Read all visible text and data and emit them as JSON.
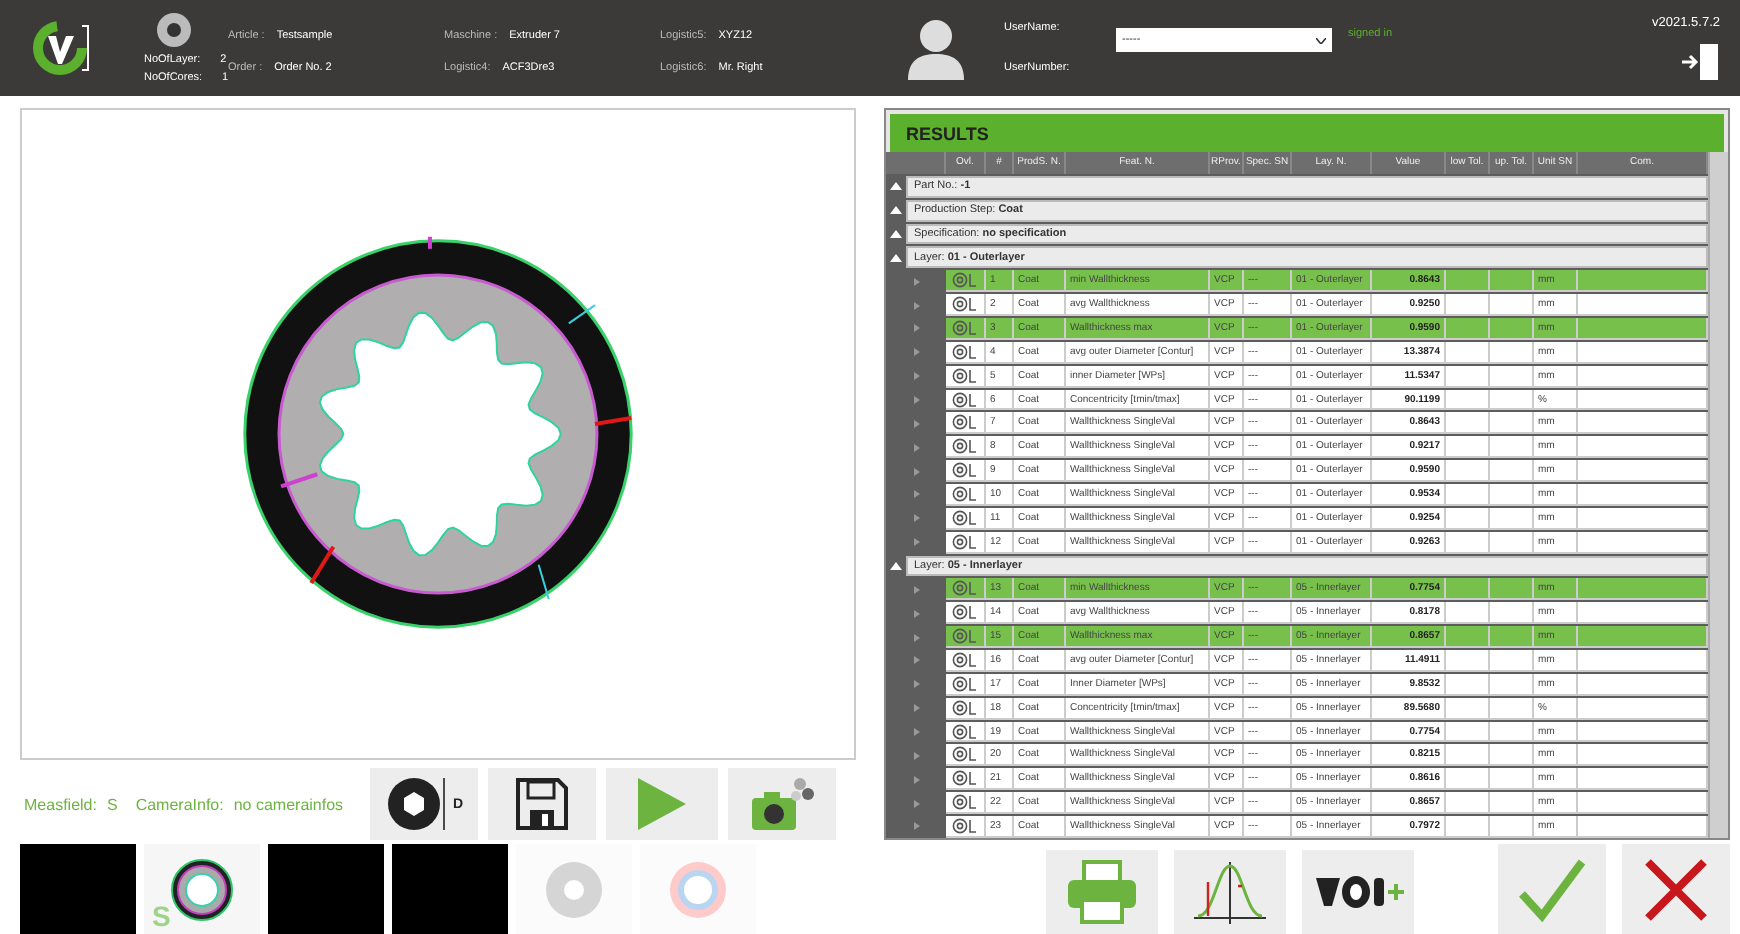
{
  "header": {
    "counts": [
      {
        "label": "NoOfLayer:",
        "value": "2"
      },
      {
        "label": "NoOfCores:",
        "value": "1"
      }
    ],
    "fields": [
      [
        {
          "label": "Article :",
          "value": "Testsample"
        },
        {
          "label": "Order :",
          "value": "Order No. 2"
        }
      ],
      [
        {
          "label": "Maschine :",
          "value": "Extruder 7"
        },
        {
          "label": "Logistic4:",
          "value": "ACF3Dre3"
        }
      ],
      [
        {
          "label": "Logistic5:",
          "value": "XYZ12"
        },
        {
          "label": "Logistic6:",
          "value": "Mr. Right"
        }
      ]
    ],
    "user": {
      "name_label": "UserName:",
      "name_value": "-----",
      "status": "signed in",
      "number_label": "UserNumber:"
    },
    "version": "v2021.5.7.2"
  },
  "diameter_label": "D",
  "status": [
    {
      "label": "Measfield:",
      "value": "S"
    },
    {
      "label": "CameraInfo:",
      "value": "no camerainfos"
    }
  ],
  "results": {
    "title": "RESULTS",
    "columns": [
      "Ovl.",
      "#",
      "ProdS. N.",
      "Feat. N.",
      "RProv.",
      "Spec. SN",
      "Lay. N.",
      "Value",
      "low Tol.",
      "up. Tol.",
      "Unit SN",
      "Com."
    ],
    "lines": [
      {
        "kind": "group",
        "label": "Part No.:",
        "value": "-1"
      },
      {
        "kind": "group",
        "label": "Production Step:",
        "value": "Coat"
      },
      {
        "kind": "group",
        "label": "Specification:",
        "value": "no specification"
      },
      {
        "kind": "group",
        "label": "Layer:",
        "value": "01 - Outerlayer"
      },
      {
        "kind": "row",
        "num": "1",
        "prod": "Coat",
        "feat": "min Wallthickness",
        "rprov": "VCP",
        "spec": "---",
        "layer": "01 - Outerlayer",
        "value": "0.8643",
        "unit": "mm",
        "highlighted": true
      },
      {
        "kind": "row",
        "num": "2",
        "prod": "Coat",
        "feat": "avg Wallthickness",
        "rprov": "VCP",
        "spec": "---",
        "layer": "01 - Outerlayer",
        "value": "0.9250",
        "unit": "mm",
        "highlighted": false
      },
      {
        "kind": "row",
        "num": "3",
        "prod": "Coat",
        "feat": "Wallthickness max",
        "rprov": "VCP",
        "spec": "---",
        "layer": "01 - Outerlayer",
        "value": "0.9590",
        "unit": "mm",
        "highlighted": true
      },
      {
        "kind": "row",
        "num": "4",
        "prod": "Coat",
        "feat": "avg outer Diameter [Contur]",
        "rprov": "VCP",
        "spec": "---",
        "layer": "01 - Outerlayer",
        "value": "13.3874",
        "unit": "mm",
        "highlighted": false
      },
      {
        "kind": "row",
        "num": "5",
        "prod": "Coat",
        "feat": "inner Diameter [WPs]",
        "rprov": "VCP",
        "spec": "---",
        "layer": "01 - Outerlayer",
        "value": "11.5347",
        "unit": "mm",
        "highlighted": false
      },
      {
        "kind": "row",
        "num": "6",
        "prod": "Coat",
        "feat": "Concentricity [tmin/tmax]",
        "rprov": "VCP",
        "spec": "---",
        "layer": "01 - Outerlayer",
        "value": "90.1199",
        "unit": "%",
        "highlighted": false
      },
      {
        "kind": "row",
        "num": "7",
        "prod": "Coat",
        "feat": "Wallthickness SingleVal",
        "rprov": "VCP",
        "spec": "---",
        "layer": "01 - Outerlayer",
        "value": "0.8643",
        "unit": "mm",
        "highlighted": false
      },
      {
        "kind": "row",
        "num": "8",
        "prod": "Coat",
        "feat": "Wallthickness SingleVal",
        "rprov": "VCP",
        "spec": "---",
        "layer": "01 - Outerlayer",
        "value": "0.9217",
        "unit": "mm",
        "highlighted": false
      },
      {
        "kind": "row",
        "num": "9",
        "prod": "Coat",
        "feat": "Wallthickness SingleVal",
        "rprov": "VCP",
        "spec": "---",
        "layer": "01 - Outerlayer",
        "value": "0.9590",
        "unit": "mm",
        "highlighted": false
      },
      {
        "kind": "row",
        "num": "10",
        "prod": "Coat",
        "feat": "Wallthickness SingleVal",
        "rprov": "VCP",
        "spec": "---",
        "layer": "01 - Outerlayer",
        "value": "0.9534",
        "unit": "mm",
        "highlighted": false
      },
      {
        "kind": "row",
        "num": "11",
        "prod": "Coat",
        "feat": "Wallthickness SingleVal",
        "rprov": "VCP",
        "spec": "---",
        "layer": "01 - Outerlayer",
        "value": "0.9254",
        "unit": "mm",
        "highlighted": false
      },
      {
        "kind": "row",
        "num": "12",
        "prod": "Coat",
        "feat": "Wallthickness SingleVal",
        "rprov": "VCP",
        "spec": "---",
        "layer": "01 - Outerlayer",
        "value": "0.9263",
        "unit": "mm",
        "highlighted": false
      },
      {
        "kind": "group",
        "label": "Layer:",
        "value": "05 - Innerlayer"
      },
      {
        "kind": "row",
        "num": "13",
        "prod": "Coat",
        "feat": "min Wallthickness",
        "rprov": "VCP",
        "spec": "---",
        "layer": "05 - Innerlayer",
        "value": "0.7754",
        "unit": "mm",
        "highlighted": true
      },
      {
        "kind": "row",
        "num": "14",
        "prod": "Coat",
        "feat": "avg Wallthickness",
        "rprov": "VCP",
        "spec": "---",
        "layer": "05 - Innerlayer",
        "value": "0.8178",
        "unit": "mm",
        "highlighted": false
      },
      {
        "kind": "row",
        "num": "15",
        "prod": "Coat",
        "feat": "Wallthickness max",
        "rprov": "VCP",
        "spec": "---",
        "layer": "05 - Innerlayer",
        "value": "0.8657",
        "unit": "mm",
        "highlighted": true
      },
      {
        "kind": "row",
        "num": "16",
        "prod": "Coat",
        "feat": "avg outer Diameter [Contur]",
        "rprov": "VCP",
        "spec": "---",
        "layer": "05 - Innerlayer",
        "value": "11.4911",
        "unit": "mm",
        "highlighted": false
      },
      {
        "kind": "row",
        "num": "17",
        "prod": "Coat",
        "feat": "Inner Diameter [WPs]",
        "rprov": "VCP",
        "spec": "---",
        "layer": "05 - Innerlayer",
        "value": "9.8532",
        "unit": "mm",
        "highlighted": false
      },
      {
        "kind": "row",
        "num": "18",
        "prod": "Coat",
        "feat": "Concentricity [tmin/tmax]",
        "rprov": "VCP",
        "spec": "---",
        "layer": "05 - Innerlayer",
        "value": "89.5680",
        "unit": "%",
        "highlighted": false
      },
      {
        "kind": "row",
        "num": "19",
        "prod": "Coat",
        "feat": "Wallthickness SingleVal",
        "rprov": "VCP",
        "spec": "---",
        "layer": "05 - Innerlayer",
        "value": "0.7754",
        "unit": "mm",
        "highlighted": false
      },
      {
        "kind": "row",
        "num": "20",
        "prod": "Coat",
        "feat": "Wallthickness SingleVal",
        "rprov": "VCP",
        "spec": "---",
        "layer": "05 - Innerlayer",
        "value": "0.8215",
        "unit": "mm",
        "highlighted": false
      },
      {
        "kind": "row",
        "num": "21",
        "prod": "Coat",
        "feat": "Wallthickness SingleVal",
        "rprov": "VCP",
        "spec": "---",
        "layer": "05 - Innerlayer",
        "value": "0.8616",
        "unit": "mm",
        "highlighted": false
      },
      {
        "kind": "row",
        "num": "22",
        "prod": "Coat",
        "feat": "Wallthickness SingleVal",
        "rprov": "VCP",
        "spec": "---",
        "layer": "05 - Innerlayer",
        "value": "0.8657",
        "unit": "mm",
        "highlighted": false
      },
      {
        "kind": "row",
        "num": "23",
        "prod": "Coat",
        "feat": "Wallthickness SingleVal",
        "rprov": "VCP",
        "spec": "---",
        "layer": "05 - Innerlayer",
        "value": "0.7972",
        "unit": "mm",
        "highlighted": false
      }
    ]
  },
  "thumbnails": [
    {
      "kind": "dark",
      "disabled": false
    },
    {
      "kind": "ring",
      "label": "S",
      "disabled": false
    },
    {
      "kind": "dark",
      "disabled": false
    },
    {
      "kind": "dark",
      "disabled": false
    },
    {
      "kind": "disc",
      "disabled": true
    },
    {
      "kind": "tube",
      "disabled": true
    }
  ]
}
